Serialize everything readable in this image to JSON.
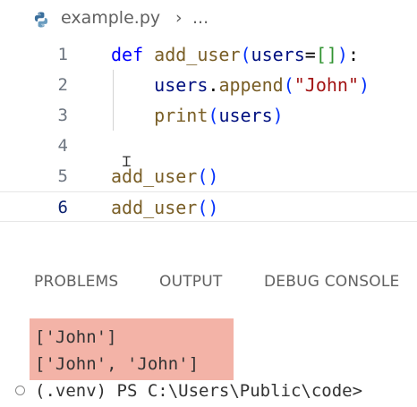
{
  "breadcrumb": {
    "icon": "python-file-icon",
    "filename": "example.py",
    "separator": "›",
    "more": "..."
  },
  "editor": {
    "lines": [
      {
        "number": "1",
        "text": "def add_user(users=[]):"
      },
      {
        "number": "2",
        "text": "users.append(\"John\")"
      },
      {
        "number": "3",
        "text": "print(users)"
      },
      {
        "number": "4",
        "text": ""
      },
      {
        "number": "5",
        "text": "add_user()"
      },
      {
        "number": "6",
        "text": "add_user()"
      }
    ],
    "current_line": "6"
  },
  "panel": {
    "tabs": [
      "PROBLEMS",
      "OUTPUT",
      "DEBUG CONSOLE"
    ]
  },
  "terminal": {
    "output": [
      "['John']",
      "['John', 'John']"
    ],
    "prompt": "(.venv) PS C:\\Users\\Public\\code>"
  },
  "colors": {
    "keyword": "#0000ff",
    "function": "#795e26",
    "variable": "#001080",
    "string": "#a31515",
    "output_highlight": "#f3b3a7"
  }
}
